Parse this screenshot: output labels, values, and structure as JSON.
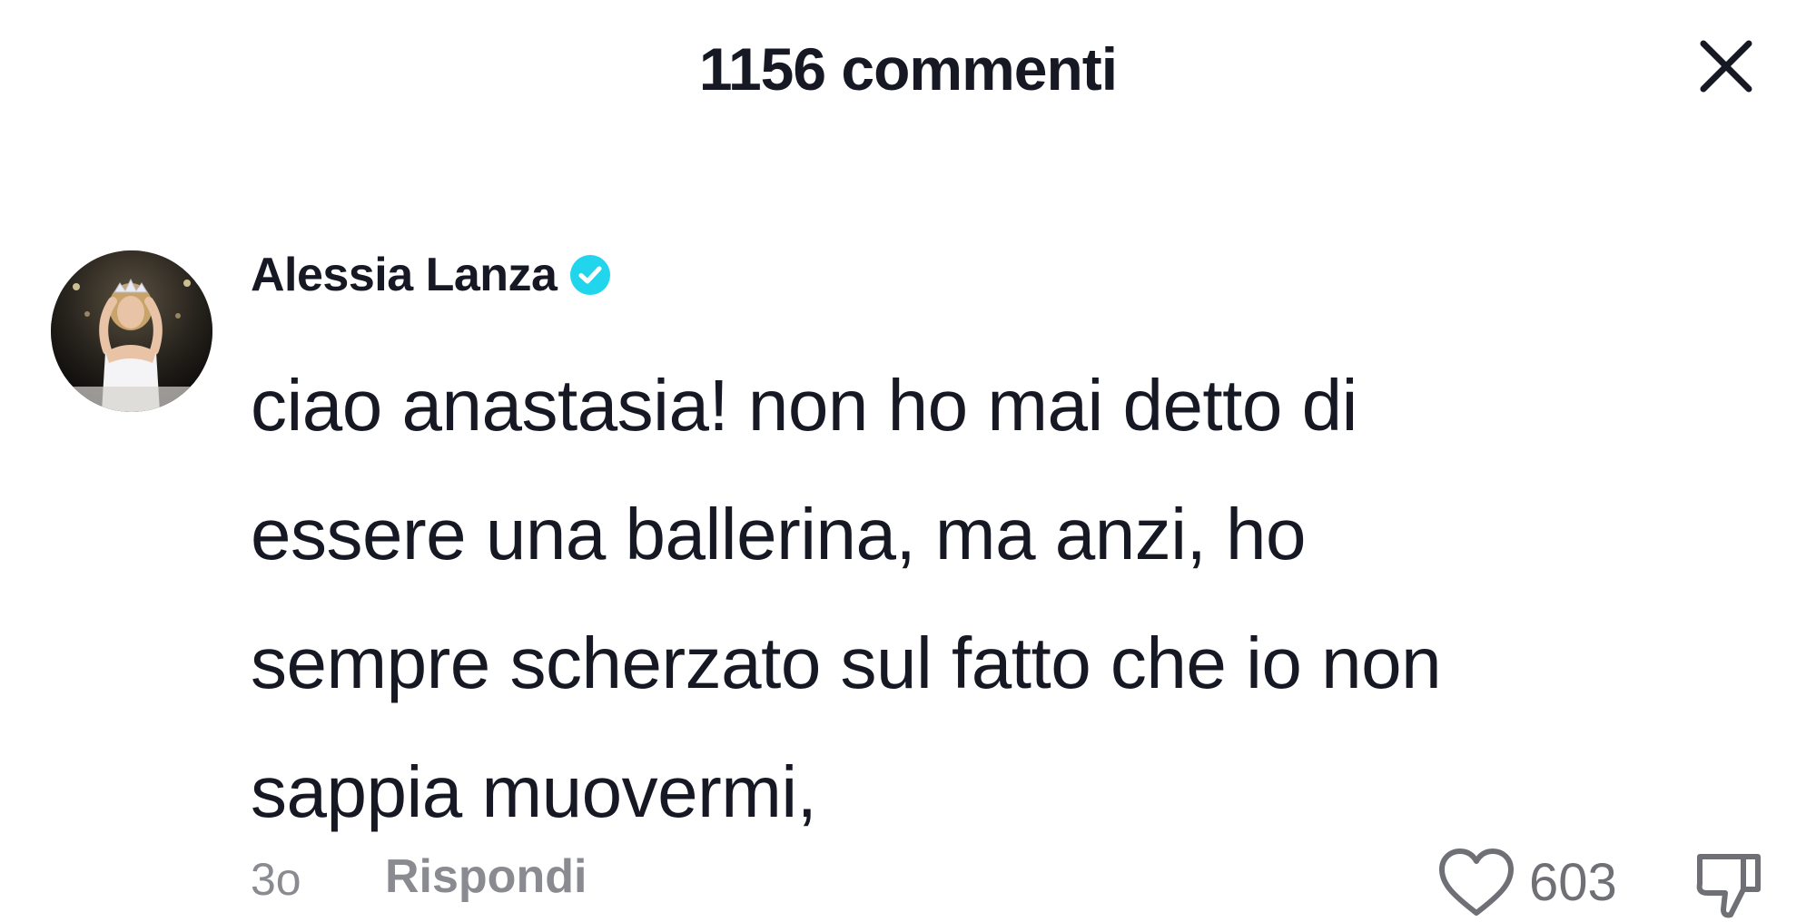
{
  "header": {
    "title": "1156 commenti",
    "close_icon": "close-icon"
  },
  "comment": {
    "author": "Alessia Lanza",
    "verified": true,
    "verified_icon": "verified-badge-icon",
    "accent_color": "#20d5ec",
    "avatar": "avatar-photo",
    "lines": [
      "ciao anastasia! non ho mai detto di",
      "essere una ballerina, ma anzi, ho",
      "sempre scherzato sul fatto che io non",
      "sappia muovermi,"
    ],
    "time": "3o",
    "reply_label": "Rispondi",
    "like_count": "603",
    "like_icon": "heart-icon",
    "dislike_icon": "thumbs-down-icon"
  }
}
